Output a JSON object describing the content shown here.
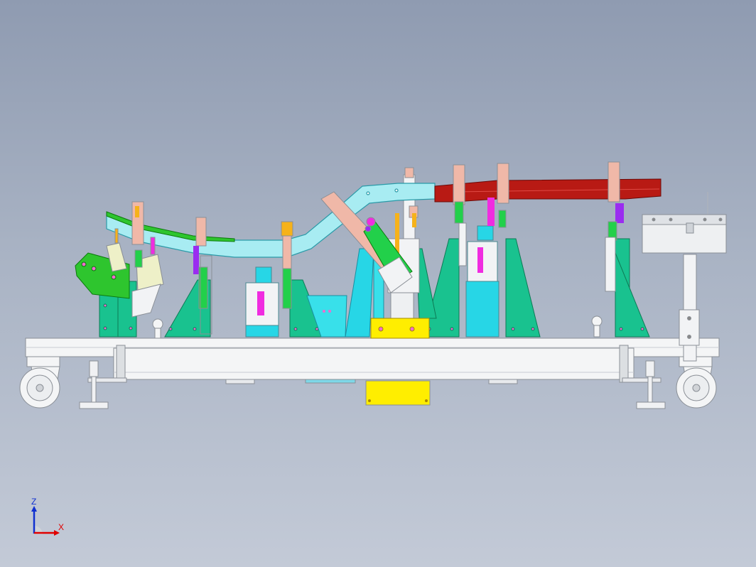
{
  "view": {
    "triad": {
      "x_label": "X",
      "z_label": "Z"
    }
  },
  "colors": {
    "background_top": "#8f9bb1",
    "background_bottom": "#c3cad7",
    "frame": "#f4f5f6",
    "frame_edge": "#8a8f96",
    "bracket": "#19c28f",
    "slider": "#f0b8a8",
    "guide": "#22d04a",
    "tube": "#a8ecf2",
    "motor_base": "#27d6e6",
    "hopper": "#38e0ea",
    "clamp_cap": "#f6b21a",
    "accent_magenta": "#f02ce0",
    "accent_purple": "#9a2cf0",
    "red_beam": "#b81a14",
    "yellow_block": "#ffee00",
    "green_plate": "#2ec52e",
    "cabinet": "#eef0f2",
    "triad_x": "#e00000",
    "triad_z": "#1030d0"
  }
}
